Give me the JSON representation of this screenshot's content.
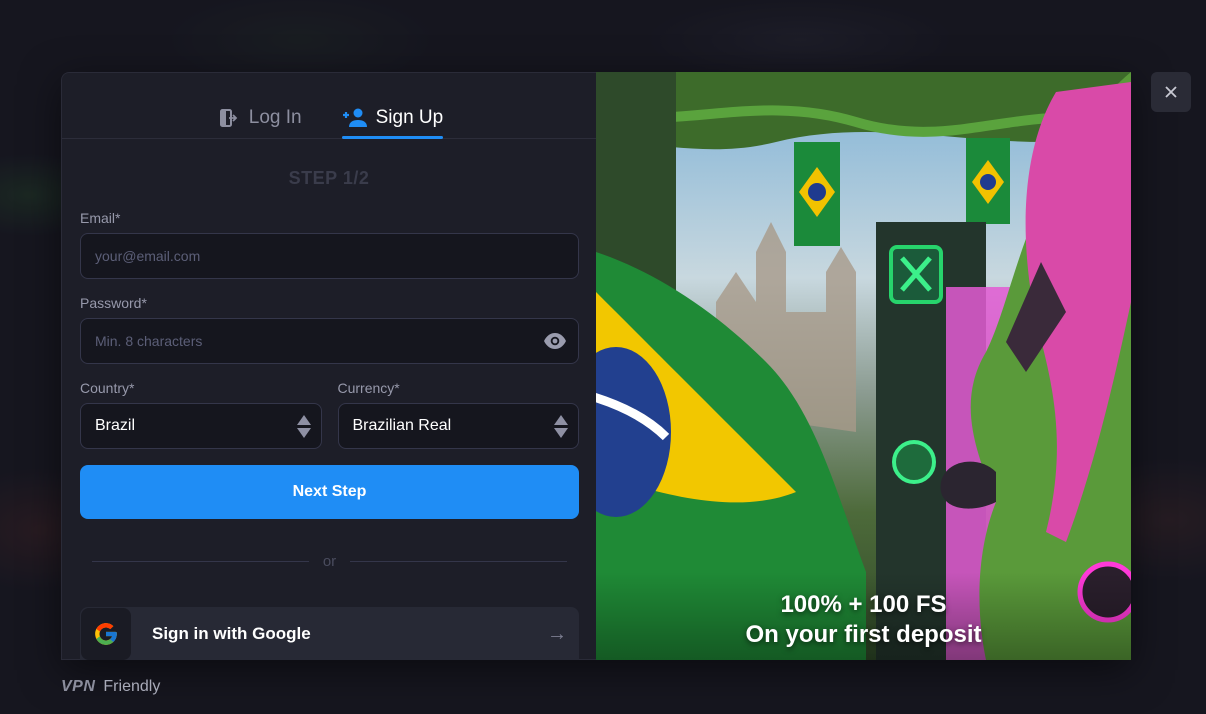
{
  "tabs": [
    {
      "label": "Log In",
      "icon": "login-door-icon",
      "active": false
    },
    {
      "label": "Sign Up",
      "icon": "add-user-icon",
      "active": true
    }
  ],
  "step_label": "STEP 1/2",
  "form": {
    "email": {
      "label": "Email*",
      "placeholder": "your@email.com",
      "value": ""
    },
    "password": {
      "label": "Password*",
      "placeholder": "Min. 8 characters",
      "value": ""
    },
    "country": {
      "label": "Country*",
      "value": "Brazil"
    },
    "currency": {
      "label": "Currency*",
      "value": "Brazilian Real"
    }
  },
  "next_button": "Next Step",
  "divider_text": "or",
  "google": {
    "label": "Sign in with Google",
    "arrow": "→"
  },
  "promo": {
    "line1": "100% + 100 FS",
    "line2": "On your first deposit"
  },
  "badge": {
    "vpn": "VPN",
    "friendly": "Friendly"
  },
  "colors": {
    "accent": "#1f8df5",
    "panel": "#1d1e28",
    "input_bg": "#15161e"
  }
}
